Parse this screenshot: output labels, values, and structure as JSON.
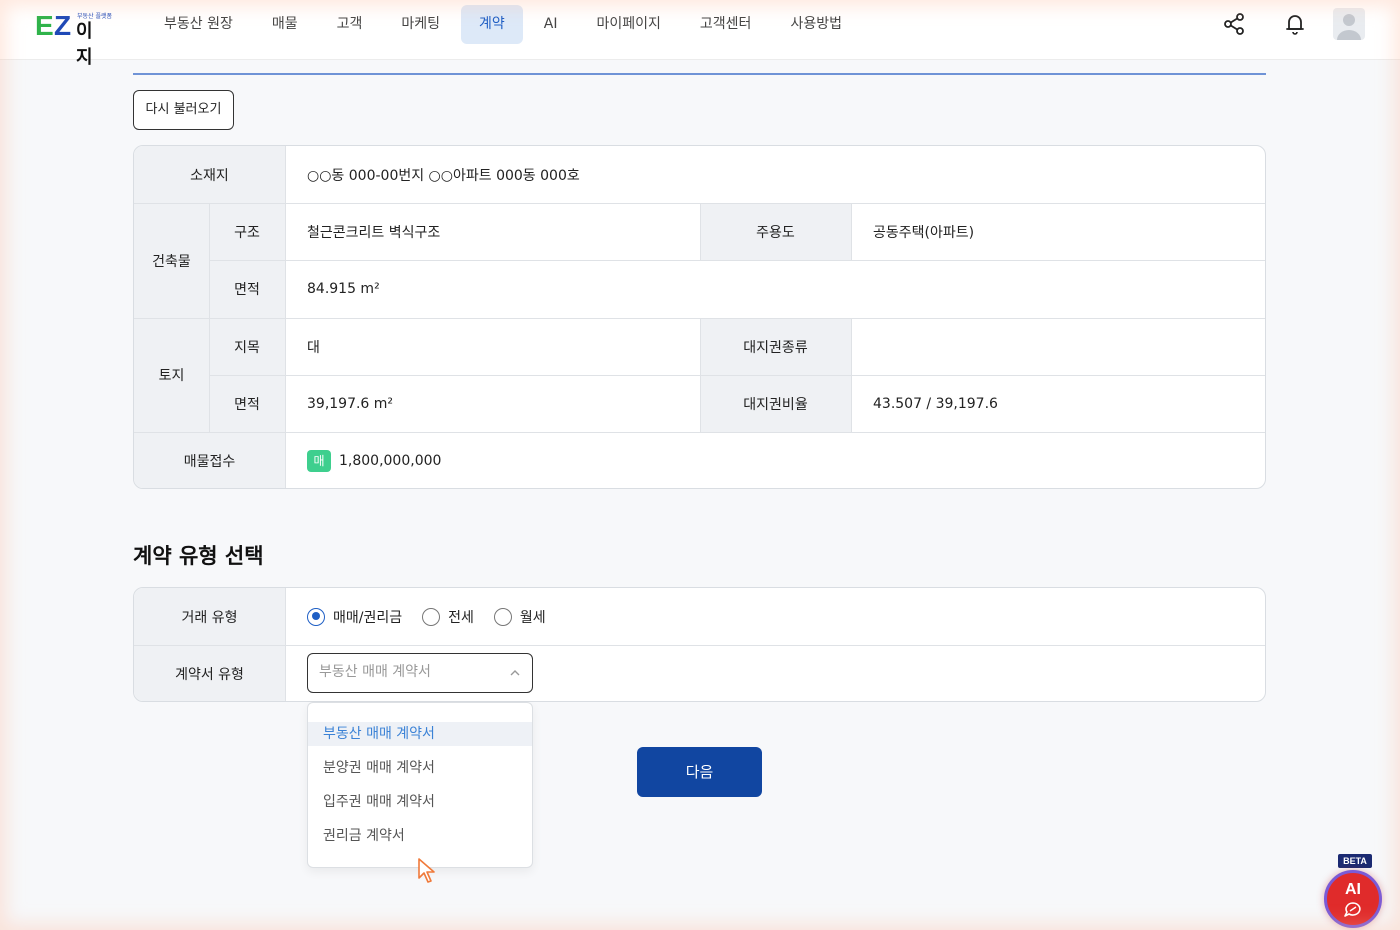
{
  "header": {
    "logo": {
      "brand_mark": "EZ",
      "sub": "부동산 플랫폼",
      "name": "이지"
    },
    "nav": [
      {
        "label": "부동산 원장"
      },
      {
        "label": "매물"
      },
      {
        "label": "고객"
      },
      {
        "label": "마케팅"
      },
      {
        "label": "계약",
        "active": true
      },
      {
        "label": "AI"
      },
      {
        "label": "마이페이지"
      },
      {
        "label": "고객센터"
      },
      {
        "label": "사용방법"
      }
    ],
    "icons": [
      "share-icon",
      "bell-icon",
      "user-avatar-icon"
    ]
  },
  "reload_button": "다시 불러오기",
  "property": {
    "location_label": "소재지",
    "location_value": "○○동 000-00번지 ○○아파트 000동 000호",
    "building_label": "건축물",
    "structure_label": "구조",
    "structure_value": "철근콘크리트 벽식구조",
    "use_label": "주용도",
    "use_value": "공동주택(아파트)",
    "building_area_label": "면적",
    "building_area_value": "84.915 m²",
    "land_label": "토지",
    "land_category_label": "지목",
    "land_category_value": "대",
    "land_right_type_label": "대지권종류",
    "land_right_type_value": "",
    "land_area_label": "면적",
    "land_area_value": "39,197.6 m²",
    "land_right_ratio_label": "대지권비율",
    "land_right_ratio_value": "43.507 / 39,197.6",
    "listing_label": "매물접수",
    "listing_badge": "매",
    "listing_price": "1,800,000,000"
  },
  "contract_section": {
    "title": "계약 유형 선택",
    "deal_type_label": "거래 유형",
    "deal_type_options": [
      {
        "label": "매매/권리금",
        "checked": true
      },
      {
        "label": "전세",
        "checked": false
      },
      {
        "label": "월세",
        "checked": false
      }
    ],
    "doc_type_label": "계약서 유형",
    "doc_type_placeholder": "부동산 매매 계약서",
    "doc_type_options": [
      "부동산 매매 계약서",
      "분양권 매매 계약서",
      "입주권 매매 계약서",
      "권리금 계약서"
    ],
    "doc_type_highlighted": "부동산 매매 계약서"
  },
  "next_button": "다음",
  "ai_widget": {
    "badge": "BETA",
    "label": "AI",
    "icon": "chat-icon"
  },
  "colors": {
    "accent": "#1f5fc5",
    "primary_button": "#1146a1",
    "badge_green": "#3ecf8e",
    "ai_red": "#e02b2b"
  }
}
